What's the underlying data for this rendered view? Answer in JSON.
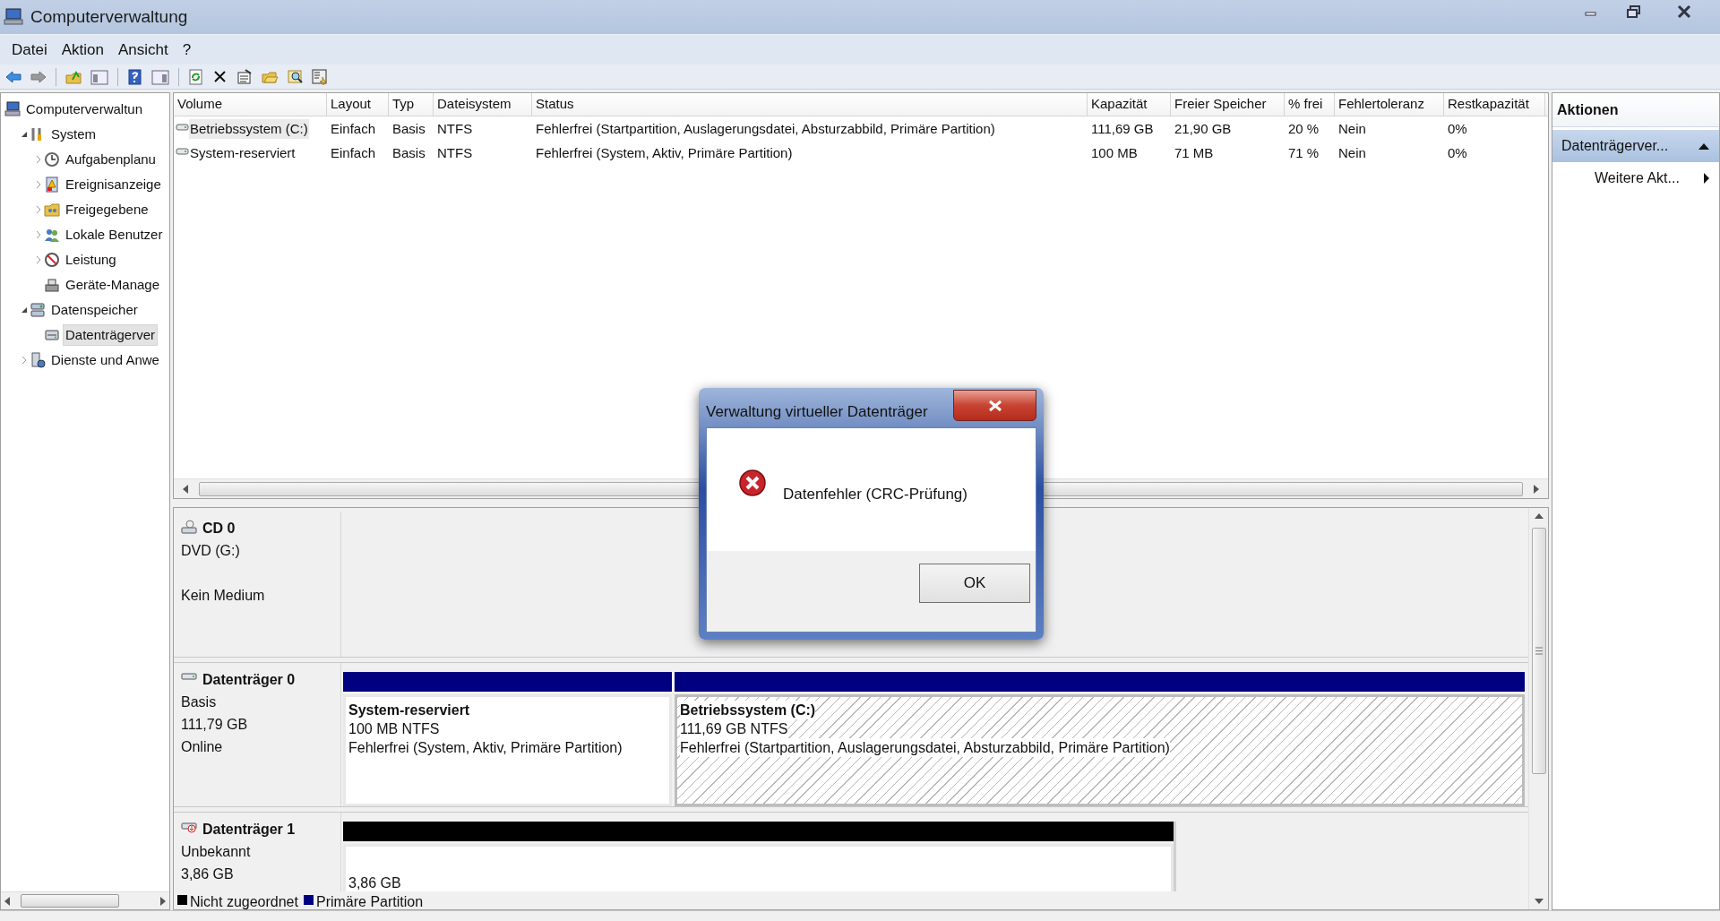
{
  "window": {
    "title": "Computerverwaltung"
  },
  "menu": [
    {
      "label": "Datei"
    },
    {
      "label": "Aktion"
    },
    {
      "label": "Ansicht"
    },
    {
      "label": "?"
    }
  ],
  "tree": [
    {
      "label": "Computerverwaltun",
      "selected": false,
      "children": [
        {
          "label": "System",
          "expanded": true,
          "selected": false,
          "children": [
            {
              "label": "Aufgabenplanu",
              "expanded": false,
              "selected": false
            },
            {
              "label": "Ereignisanzeige",
              "expanded": false,
              "selected": false
            },
            {
              "label": "Freigegebene",
              "expanded": false,
              "selected": false
            },
            {
              "label": "Lokale Benutzer",
              "expanded": false,
              "selected": false
            },
            {
              "label": "Leistung",
              "expanded": false,
              "selected": false
            },
            {
              "label": "Geräte-Manage",
              "selected": false
            }
          ]
        },
        {
          "label": "Datenspeicher",
          "expanded": true,
          "selected": false,
          "children": [
            {
              "label": "Datenträgerver",
              "selected": true
            }
          ]
        },
        {
          "label": "Dienste und Anwe",
          "expanded": false,
          "selected": false
        }
      ]
    }
  ],
  "table": {
    "columns": [
      "Volume",
      "Layout",
      "Typ",
      "Dateisystem",
      "Status",
      "Kapazität",
      "Freier Speicher",
      "% frei",
      "Fehlertoleranz",
      "Restkapazität"
    ],
    "rows": [
      {
        "selected": true,
        "cells": [
          "Betriebssystem (C:)",
          "Einfach",
          "Basis",
          "NTFS",
          "Fehlerfrei (Startpartition, Auslagerungsdatei, Absturzabbild, Primäre Partition)",
          "111,69 GB",
          "21,90 GB",
          "20 %",
          "Nein",
          "0%"
        ]
      },
      {
        "selected": false,
        "cells": [
          "System-reserviert",
          "Einfach",
          "Basis",
          "NTFS",
          "Fehlerfrei (System, Aktiv, Primäre Partition)",
          "100 MB",
          "71 MB",
          "71 %",
          "Nein",
          "0%"
        ]
      }
    ]
  },
  "disks": [
    {
      "kind": "cd",
      "name": "CD 0",
      "lines": [
        "DVD (G:)",
        "Kein Medium"
      ]
    },
    {
      "kind": "disk",
      "name": "Datenträger 0",
      "lines": [
        "Basis",
        "111,79 GB",
        "Online"
      ],
      "partitions": [
        {
          "kind": "primary",
          "color": "#000080",
          "selected": false,
          "name": "System-reserviert",
          "size": "100 MB NTFS",
          "status": "Fehlerfrei (System, Aktiv, Primäre Partition)"
        },
        {
          "kind": "primary",
          "color": "#000080",
          "selected": true,
          "name": "Betriebssystem (C:)",
          "size": "111,69 GB NTFS",
          "status": "Fehlerfrei (Startpartition, Auslagerungsdatei, Absturzabbild, Primäre Partition)"
        }
      ]
    },
    {
      "kind": "unknown",
      "name": "Datenträger 1",
      "lines": [
        "Unbekannt",
        "3,86 GB"
      ],
      "partitions": [
        {
          "kind": "unallocated",
          "color": "#000000",
          "selected": false,
          "size": "3,86 GB"
        }
      ]
    }
  ],
  "legend": [
    {
      "label": "Nicht zugeordnet",
      "color": "#000000"
    },
    {
      "label": "Primäre Partition",
      "color": "#000080"
    }
  ],
  "actions": {
    "title": "Aktionen",
    "sections": [
      {
        "label": "Datenträgerver...",
        "expanded": true,
        "items": [
          {
            "label": "Weitere Akt...",
            "submenu": true
          }
        ]
      }
    ]
  },
  "dialog": {
    "title": "Verwaltung virtueller Datenträger",
    "message": "Datenfehler (CRC-Prüfung)",
    "buttons": [
      "OK"
    ]
  }
}
